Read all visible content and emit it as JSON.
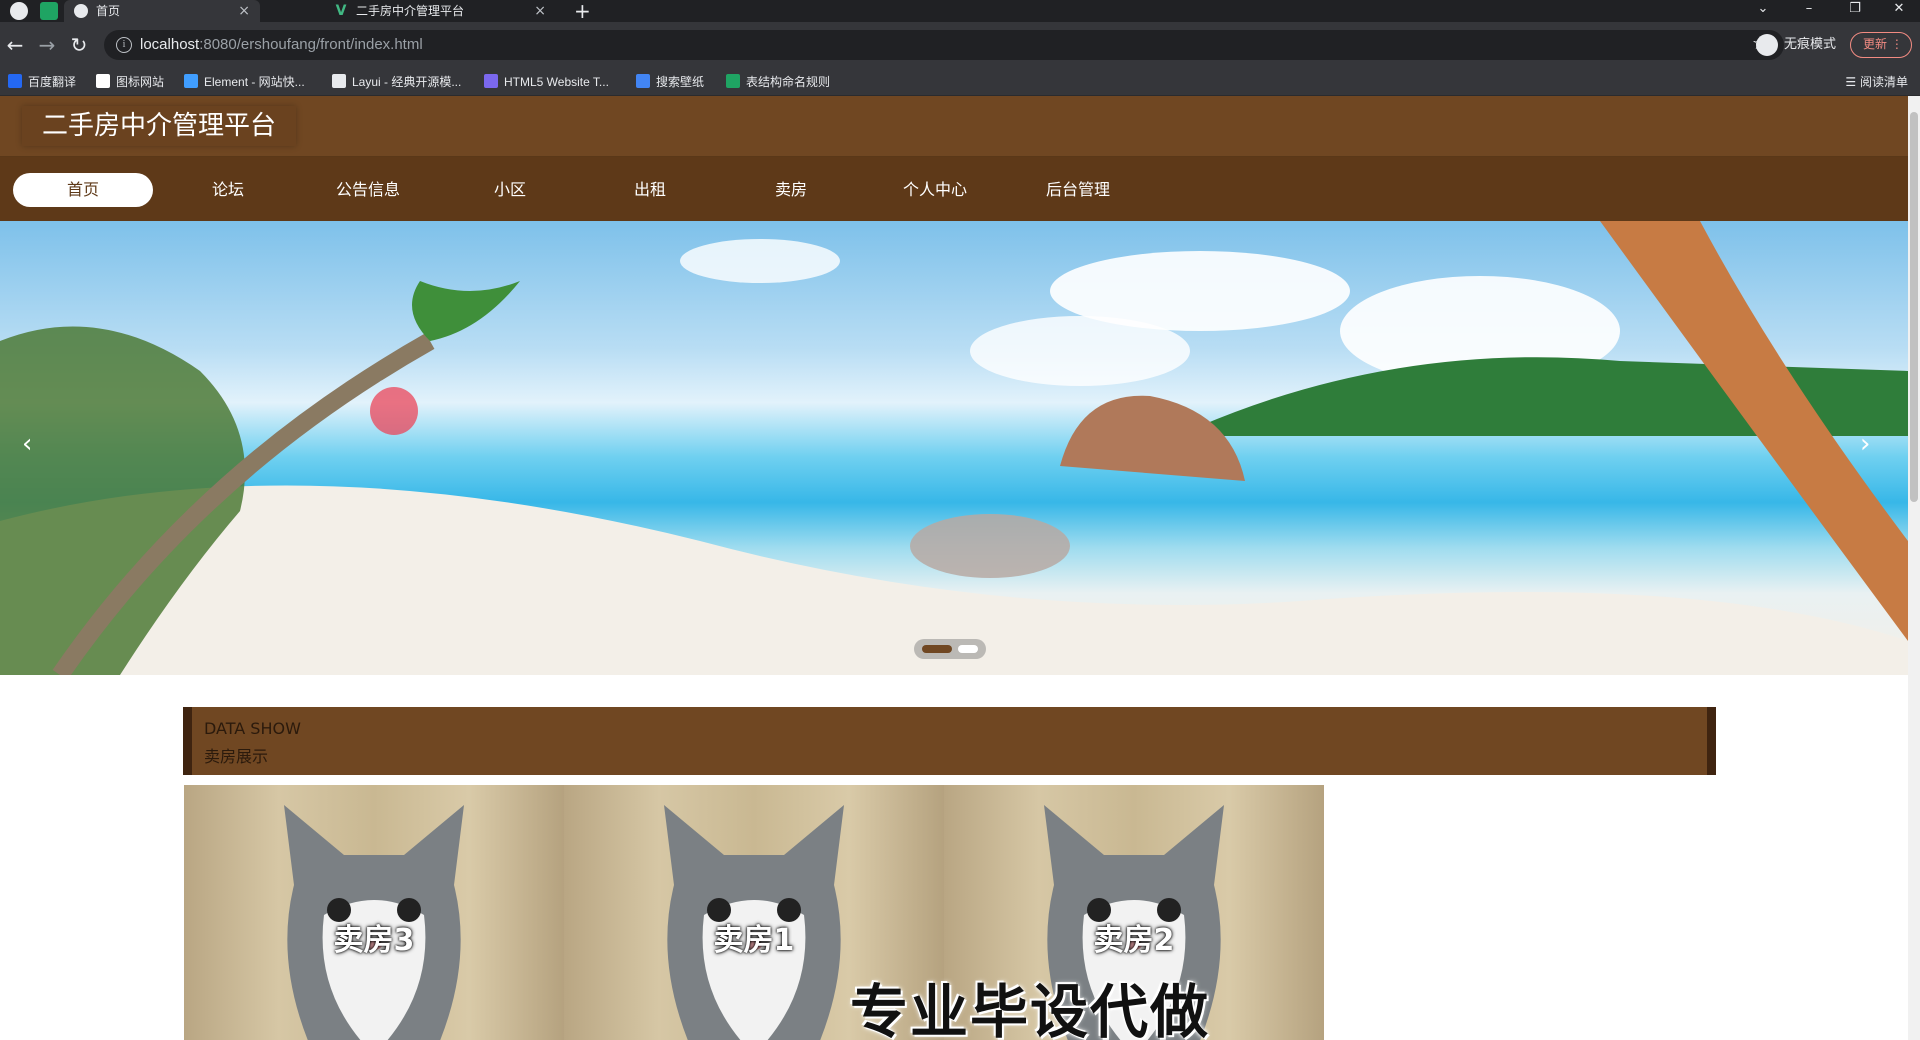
{
  "browser": {
    "tabs": [
      {
        "title": "首页",
        "active": true
      },
      {
        "title": "二手房中介管理平台",
        "active": false
      }
    ],
    "url_host": "localhost",
    "url_rest": ":8080/ershoufang/front/index.html",
    "incognito_label": "无痕模式",
    "update_label": "更新",
    "bookmarks": [
      {
        "label": "百度翻译",
        "color": "#2468f2"
      },
      {
        "label": "图标网站",
        "color": "#ffffff"
      },
      {
        "label": "Element - 网站快...",
        "color": "#409eff"
      },
      {
        "label": "Layui - 经典开源模...",
        "color": "#e8eaed"
      },
      {
        "label": "HTML5 Website T...",
        "color": "#7b68ee"
      },
      {
        "label": "搜索壁纸",
        "color": "#4285f4"
      },
      {
        "label": "表结构命名规则",
        "color": "#1fa463"
      }
    ],
    "reading_list_label": "阅读清单"
  },
  "site": {
    "title": "二手房中介管理平台",
    "nav": [
      {
        "label": "首页",
        "active": true
      },
      {
        "label": "论坛",
        "active": false
      },
      {
        "label": "公告信息",
        "active": false
      },
      {
        "label": "小区",
        "active": false
      },
      {
        "label": "出租",
        "active": false
      },
      {
        "label": "卖房",
        "active": false
      },
      {
        "label": "个人中心",
        "active": false
      },
      {
        "label": "后台管理",
        "active": false
      }
    ],
    "carousel": {
      "slides": 2,
      "current": 1
    },
    "section": {
      "en": "DATA SHOW",
      "cn": "卖房展示"
    },
    "cards": [
      {
        "label": "卖房3"
      },
      {
        "label": "卖房1"
      },
      {
        "label": "卖房2"
      }
    ],
    "watermark": "专业毕设代做"
  },
  "colors": {
    "brand_brown": "#704722",
    "nav_brown": "#5e3918"
  }
}
